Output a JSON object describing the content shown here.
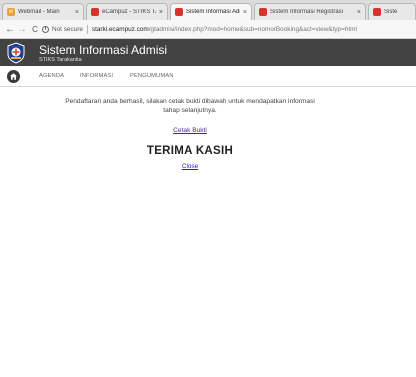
{
  "browser": {
    "tabs": [
      {
        "label": "Webmail - Main",
        "icon": "webmail-icon",
        "color": "#e8a23a",
        "active": false
      },
      {
        "label": "eCampuz - STIKS TARAKANITA",
        "icon": "ecampuz-icon",
        "color": "#d9342b",
        "active": false
      },
      {
        "label": "Sistem Informasi Admisi",
        "icon": "site-icon",
        "color": "#d9342b",
        "active": true
      },
      {
        "label": "Sistem Informasi Registrasi",
        "icon": "site-icon",
        "color": "#d9342b",
        "active": false
      },
      {
        "label": "Siste",
        "icon": "site-icon",
        "color": "#d9342b",
        "active": false
      }
    ],
    "close_glyph": "×",
    "nav": {
      "back": "←",
      "forward": "→",
      "reload": "C"
    },
    "security_label": "Not secure",
    "url_host": "starki.ecampuz.com",
    "url_path": "/gtadmisi/index.php?mod=home&sub=nomorBooking&act=view&typ=html"
  },
  "site": {
    "title": "Sistem Informasi Admisi",
    "subtitle": "STIKS Tarakanita",
    "brand_color": "#424242",
    "menu": [
      "AGENDA",
      "INFORMASI",
      "PENGUMUMAN"
    ]
  },
  "content": {
    "message_line1": "Pendaftaran anda berhasil, silakan cetak bukti dibawah untuk mendapatkan informasi",
    "message_line2": "tahap selanjutnya.",
    "print_link": "Cetak Bukti",
    "thanks": "TERIMA KASIH",
    "close_link": "Close"
  }
}
